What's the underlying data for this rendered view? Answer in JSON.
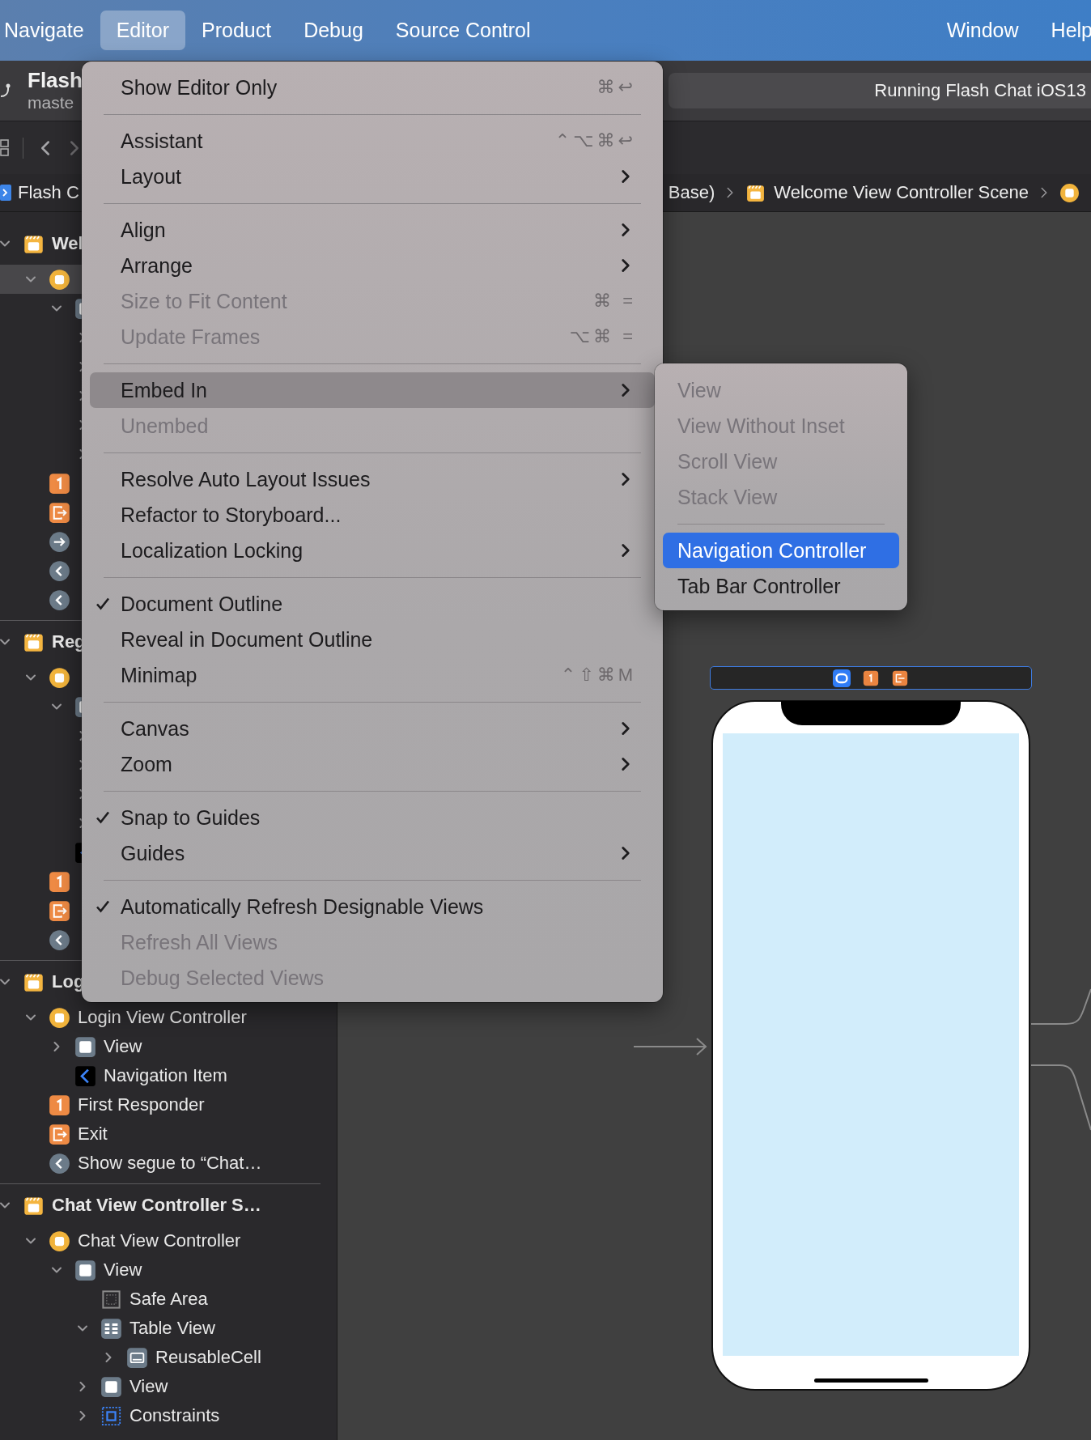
{
  "menubar": {
    "items": [
      {
        "label": "Navigate",
        "selected": false
      },
      {
        "label": "Editor",
        "selected": true
      },
      {
        "label": "Product",
        "selected": false
      },
      {
        "label": "Debug",
        "selected": false
      },
      {
        "label": "Source Control",
        "selected": false
      }
    ],
    "right_items": [
      {
        "label": "Window",
        "selected": false
      },
      {
        "label": "Help",
        "selected": false
      }
    ]
  },
  "toolbar": {
    "project": "Flash",
    "branch": "maste",
    "status": "Running Flash Chat iOS13"
  },
  "breadcrumb": {
    "root": {
      "kind": "storyboard",
      "label": "Flash C"
    },
    "trail": [
      {
        "kind": "text",
        "label": "Base)"
      },
      {
        "kind": "scene",
        "label": "Welcome View Controller Scene"
      },
      {
        "kind": "controller"
      }
    ]
  },
  "outline": {
    "scenes": [
      {
        "label": "Wel",
        "expanded": true,
        "children": [
          {
            "kind": "controller",
            "expanded": true,
            "selected": true,
            "children": [
              {
                "kind": "view",
                "expanded": true,
                "selected": false,
                "children": [
                  {
                    "expanded": false,
                    "selected": false
                  },
                  {
                    "expanded": false,
                    "selected": false
                  },
                  {
                    "expanded": false,
                    "selected": false
                  },
                  {
                    "expanded": false,
                    "selected": false
                  },
                  {
                    "expanded": false,
                    "selected": false
                  }
                ]
              }
            ]
          },
          {
            "kind": "responder",
            "selected": false
          },
          {
            "kind": "exit",
            "selected": false
          },
          {
            "kind": "segue-forward",
            "selected": false
          },
          {
            "kind": "segue-back",
            "selected": false
          },
          {
            "kind": "segue-back",
            "selected": false
          }
        ]
      },
      {
        "label": "Reg",
        "expanded": true,
        "children": [
          {
            "kind": "controller",
            "expanded": true,
            "selected": false,
            "children": [
              {
                "kind": "view",
                "expanded": true,
                "selected": false,
                "children": [
                  {
                    "expanded": false,
                    "selected": false
                  },
                  {
                    "expanded": false,
                    "selected": false
                  },
                  {
                    "expanded": false,
                    "selected": false
                  },
                  {
                    "expanded": false,
                    "selected": false
                  }
                ]
              },
              {
                "kind": "nav-item",
                "selected": false
              }
            ]
          },
          {
            "kind": "responder",
            "selected": false
          },
          {
            "kind": "exit",
            "selected": false
          },
          {
            "kind": "segue-back",
            "selected": false
          }
        ]
      },
      {
        "label": "Log",
        "expanded": true,
        "children": [
          {
            "kind": "controller",
            "label": "Login View Controller",
            "expanded": true,
            "selected": false,
            "children": [
              {
                "kind": "view",
                "label": "View",
                "expanded": false,
                "selected": false
              },
              {
                "kind": "nav-item",
                "label": "Navigation Item",
                "selected": false
              }
            ]
          },
          {
            "kind": "responder",
            "label": "First Responder",
            "selected": false
          },
          {
            "kind": "exit",
            "label": "Exit",
            "selected": false
          },
          {
            "kind": "segue-back",
            "label": "Show segue to “Chat…",
            "selected": false
          }
        ]
      },
      {
        "label": "Chat View Controller S…",
        "expanded": true,
        "children": [
          {
            "kind": "controller",
            "label": "Chat View Controller",
            "expanded": true,
            "selected": false,
            "children": [
              {
                "kind": "view",
                "label": "View",
                "expanded": true,
                "selected": false,
                "children": [
                  {
                    "kind": "safe-area",
                    "label": "Safe Area",
                    "selected": false
                  },
                  {
                    "kind": "table",
                    "label": "Table View",
                    "expanded": true,
                    "selected": false,
                    "children": [
                      {
                        "kind": "cell",
                        "label": "ReusableCell",
                        "expanded": false,
                        "selected": false
                      }
                    ]
                  },
                  {
                    "kind": "view",
                    "label": "View",
                    "expanded": false,
                    "selected": false
                  },
                  {
                    "kind": "constraints",
                    "label": "Constraints",
                    "expanded": false,
                    "selected": false
                  }
                ]
              }
            ]
          }
        ]
      }
    ]
  },
  "menu": {
    "items": [
      {
        "kind": "item",
        "label": "Show Editor Only",
        "shortcut": "⌘↩",
        "disabled": false,
        "checked": false,
        "submenu": false,
        "selected": false
      },
      {
        "kind": "separator"
      },
      {
        "kind": "item",
        "label": "Assistant",
        "shortcut": "⌃⌥⌘↩",
        "disabled": false,
        "checked": false,
        "submenu": false,
        "selected": false
      },
      {
        "kind": "item",
        "label": "Layout",
        "disabled": false,
        "checked": false,
        "submenu": true,
        "selected": false
      },
      {
        "kind": "separator"
      },
      {
        "kind": "item",
        "label": "Align",
        "disabled": false,
        "checked": false,
        "submenu": true,
        "selected": false
      },
      {
        "kind": "item",
        "label": "Arrange",
        "disabled": false,
        "checked": false,
        "submenu": true,
        "selected": false
      },
      {
        "kind": "item",
        "label": "Size to Fit Content",
        "shortcut": "⌘ =",
        "disabled": true,
        "checked": false,
        "submenu": false,
        "selected": false
      },
      {
        "kind": "item",
        "label": "Update Frames",
        "shortcut": "⌥⌘ =",
        "disabled": true,
        "checked": false,
        "submenu": false,
        "selected": false
      },
      {
        "kind": "separator"
      },
      {
        "kind": "item",
        "label": "Embed In",
        "disabled": false,
        "checked": false,
        "submenu": true,
        "selected": true
      },
      {
        "kind": "item",
        "label": "Unembed",
        "disabled": true,
        "checked": false,
        "submenu": false,
        "selected": false
      },
      {
        "kind": "separator"
      },
      {
        "kind": "item",
        "label": "Resolve Auto Layout Issues",
        "disabled": false,
        "checked": false,
        "submenu": true,
        "selected": false
      },
      {
        "kind": "item",
        "label": "Refactor to Storyboard...",
        "disabled": false,
        "checked": false,
        "submenu": false,
        "selected": false
      },
      {
        "kind": "item",
        "label": "Localization Locking",
        "disabled": false,
        "checked": false,
        "submenu": true,
        "selected": false
      },
      {
        "kind": "separator"
      },
      {
        "kind": "item",
        "label": "Document Outline",
        "disabled": false,
        "checked": true,
        "submenu": false,
        "selected": false
      },
      {
        "kind": "item",
        "label": "Reveal in Document Outline",
        "disabled": false,
        "checked": false,
        "submenu": false,
        "selected": false
      },
      {
        "kind": "item",
        "label": "Minimap",
        "shortcut": "⌃⇧⌘M",
        "disabled": false,
        "checked": false,
        "submenu": false,
        "selected": false
      },
      {
        "kind": "separator"
      },
      {
        "kind": "item",
        "label": "Canvas",
        "disabled": false,
        "checked": false,
        "submenu": true,
        "selected": false
      },
      {
        "kind": "item",
        "label": "Zoom",
        "disabled": false,
        "checked": false,
        "submenu": true,
        "selected": false
      },
      {
        "kind": "separator"
      },
      {
        "kind": "item",
        "label": "Snap to Guides",
        "disabled": false,
        "checked": true,
        "submenu": false,
        "selected": false
      },
      {
        "kind": "item",
        "label": "Guides",
        "disabled": false,
        "checked": false,
        "submenu": true,
        "selected": false
      },
      {
        "kind": "separator"
      },
      {
        "kind": "item",
        "label": "Automatically Refresh Designable Views",
        "disabled": false,
        "checked": true,
        "submenu": false,
        "selected": false
      },
      {
        "kind": "item",
        "label": "Refresh All Views",
        "disabled": true,
        "checked": false,
        "submenu": false,
        "selected": false
      },
      {
        "kind": "item",
        "label": "Debug Selected Views",
        "disabled": true,
        "checked": false,
        "submenu": false,
        "selected": false
      }
    ]
  },
  "submenu": {
    "items": [
      {
        "kind": "item",
        "label": "View",
        "disabled": true,
        "selected": false
      },
      {
        "kind": "item",
        "label": "View Without Inset",
        "disabled": true,
        "selected": false
      },
      {
        "kind": "item",
        "label": "Scroll View",
        "disabled": true,
        "selected": false
      },
      {
        "kind": "item",
        "label": "Stack View",
        "disabled": true,
        "selected": false
      },
      {
        "kind": "separator"
      },
      {
        "kind": "item",
        "label": "Navigation Controller",
        "disabled": false,
        "selected": true
      },
      {
        "kind": "item",
        "label": "Tab Bar Controller",
        "disabled": false,
        "selected": false
      }
    ]
  },
  "canvas": {
    "scene_dock": [
      {
        "kind": "controller"
      },
      {
        "kind": "responder"
      },
      {
        "kind": "exit"
      }
    ]
  }
}
